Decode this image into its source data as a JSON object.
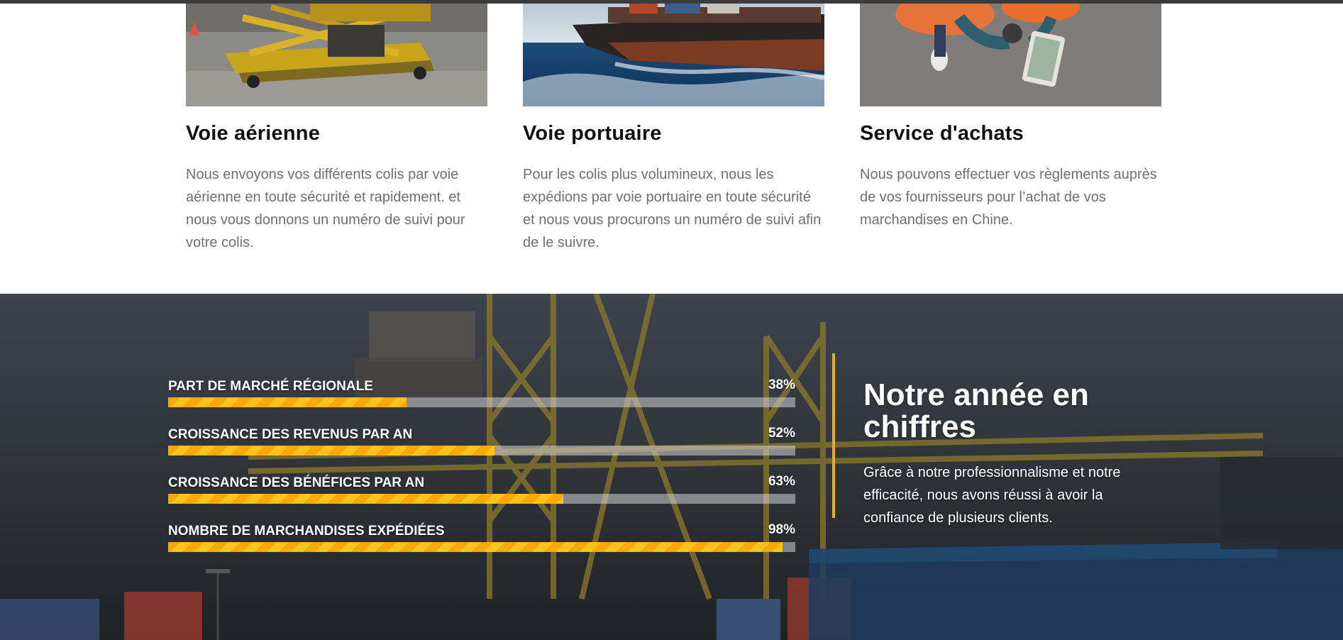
{
  "services": [
    {
      "title": "Voie aérienne",
      "description": "Nous envoyons vos différents colis par voie aérienne en toute sécurité et rapidement. et nous vous donnons un numéro de suivi pour votre colis.",
      "image": "air-cargo-loader-image"
    },
    {
      "title": "Voie portuaire",
      "description": "Pour les colis plus volumineux, nous les expédions par voie portuaire en toute sécurité et nous vous procurons un numéro de suivi afin de le suivre.",
      "image": "container-ship-image"
    },
    {
      "title": "Service d'achats",
      "description": "Nous pouvons effectuer vos règlements auprès de vos fournisseurs pour l’achat de vos marchandises en Chine.",
      "image": "workers-tablet-image"
    }
  ],
  "stats": {
    "bars": [
      {
        "label": "PART DE MARCHÉ RÉGIONALE",
        "value_label": "38%",
        "fraction": 0.38
      },
      {
        "label": "CROISSANCE DES REVENUS PAR AN",
        "value_label": "52%",
        "fraction": 0.52
      },
      {
        "label": "CROISSANCE DES BÉNÉFICES PAR AN",
        "value_label": "63%",
        "fraction": 0.63
      },
      {
        "label": "NOMBRE DE MARCHANDISES EXPÉDIÉES",
        "value_label": "98%",
        "fraction": 0.98
      }
    ],
    "heading": "Notre année en chiffres",
    "text": "Grâce à notre professionnalisme et notre efficacité, nous avons réussi à avoir la confiance de plusieurs clients.",
    "background": "port-cranes-background-image"
  },
  "colors": {
    "accent": "#f8a80a",
    "heading": "#111111",
    "body_text": "#6f6f6f",
    "dark_bg": "#2c2e33"
  }
}
